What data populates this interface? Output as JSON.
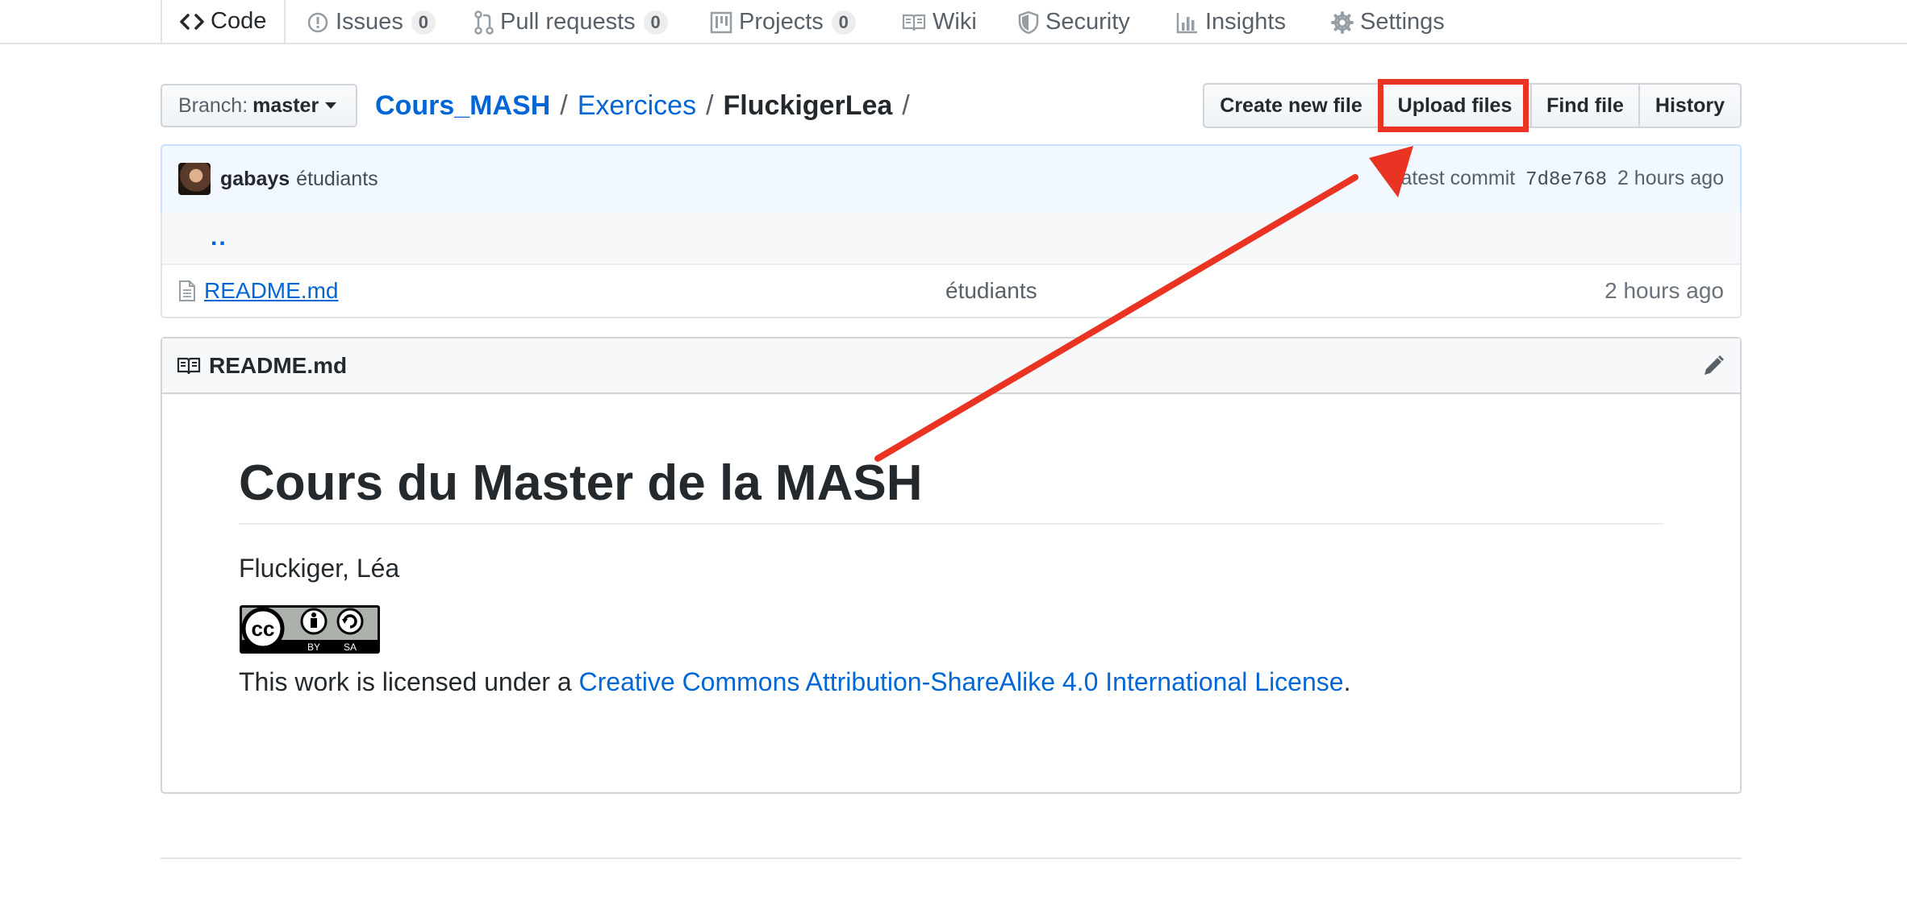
{
  "nav": {
    "tabs": [
      {
        "label": "Code",
        "icon": "code-icon",
        "selected": true
      },
      {
        "label": "Issues",
        "icon": "issue-icon",
        "count": "0"
      },
      {
        "label": "Pull requests",
        "icon": "pull-request-icon",
        "count": "0"
      },
      {
        "label": "Projects",
        "icon": "project-icon",
        "count": "0"
      },
      {
        "label": "Wiki",
        "icon": "book-icon"
      },
      {
        "label": "Security",
        "icon": "shield-icon"
      },
      {
        "label": "Insights",
        "icon": "graph-icon"
      },
      {
        "label": "Settings",
        "icon": "gear-icon"
      }
    ]
  },
  "branch": {
    "label": "Branch:",
    "value": "master"
  },
  "breadcrumb": {
    "root": "Cours_MASH",
    "sep": "/",
    "folder": "Exercices",
    "current": "FluckigerLea"
  },
  "actions": {
    "create_new_file": "Create new file",
    "upload_files": "Upload files",
    "find_file": "Find file",
    "history": "History"
  },
  "commit": {
    "author": "gabays",
    "message": "étudiants",
    "latest_label": "Latest commit",
    "sha": "7d8e768",
    "age": "2 hours ago"
  },
  "files": {
    "parent_dir": "..",
    "rows": [
      {
        "name": "README.md",
        "message": "étudiants",
        "age": "2 hours ago"
      }
    ]
  },
  "readme": {
    "filename": "README.md",
    "title": "Cours du Master de la MASH",
    "author": "Fluckiger, Léa",
    "badge": {
      "cc": "cc",
      "by": "BY",
      "sa": "SA"
    },
    "license_prefix": "This work is licensed under a",
    "license_link": "Creative Commons Attribution-ShareAlike 4.0 International License",
    "license_suffix": "."
  },
  "colors": {
    "link": "#0366d6",
    "annotation_red": "#ea3323",
    "tab_accent": "#e36209"
  }
}
